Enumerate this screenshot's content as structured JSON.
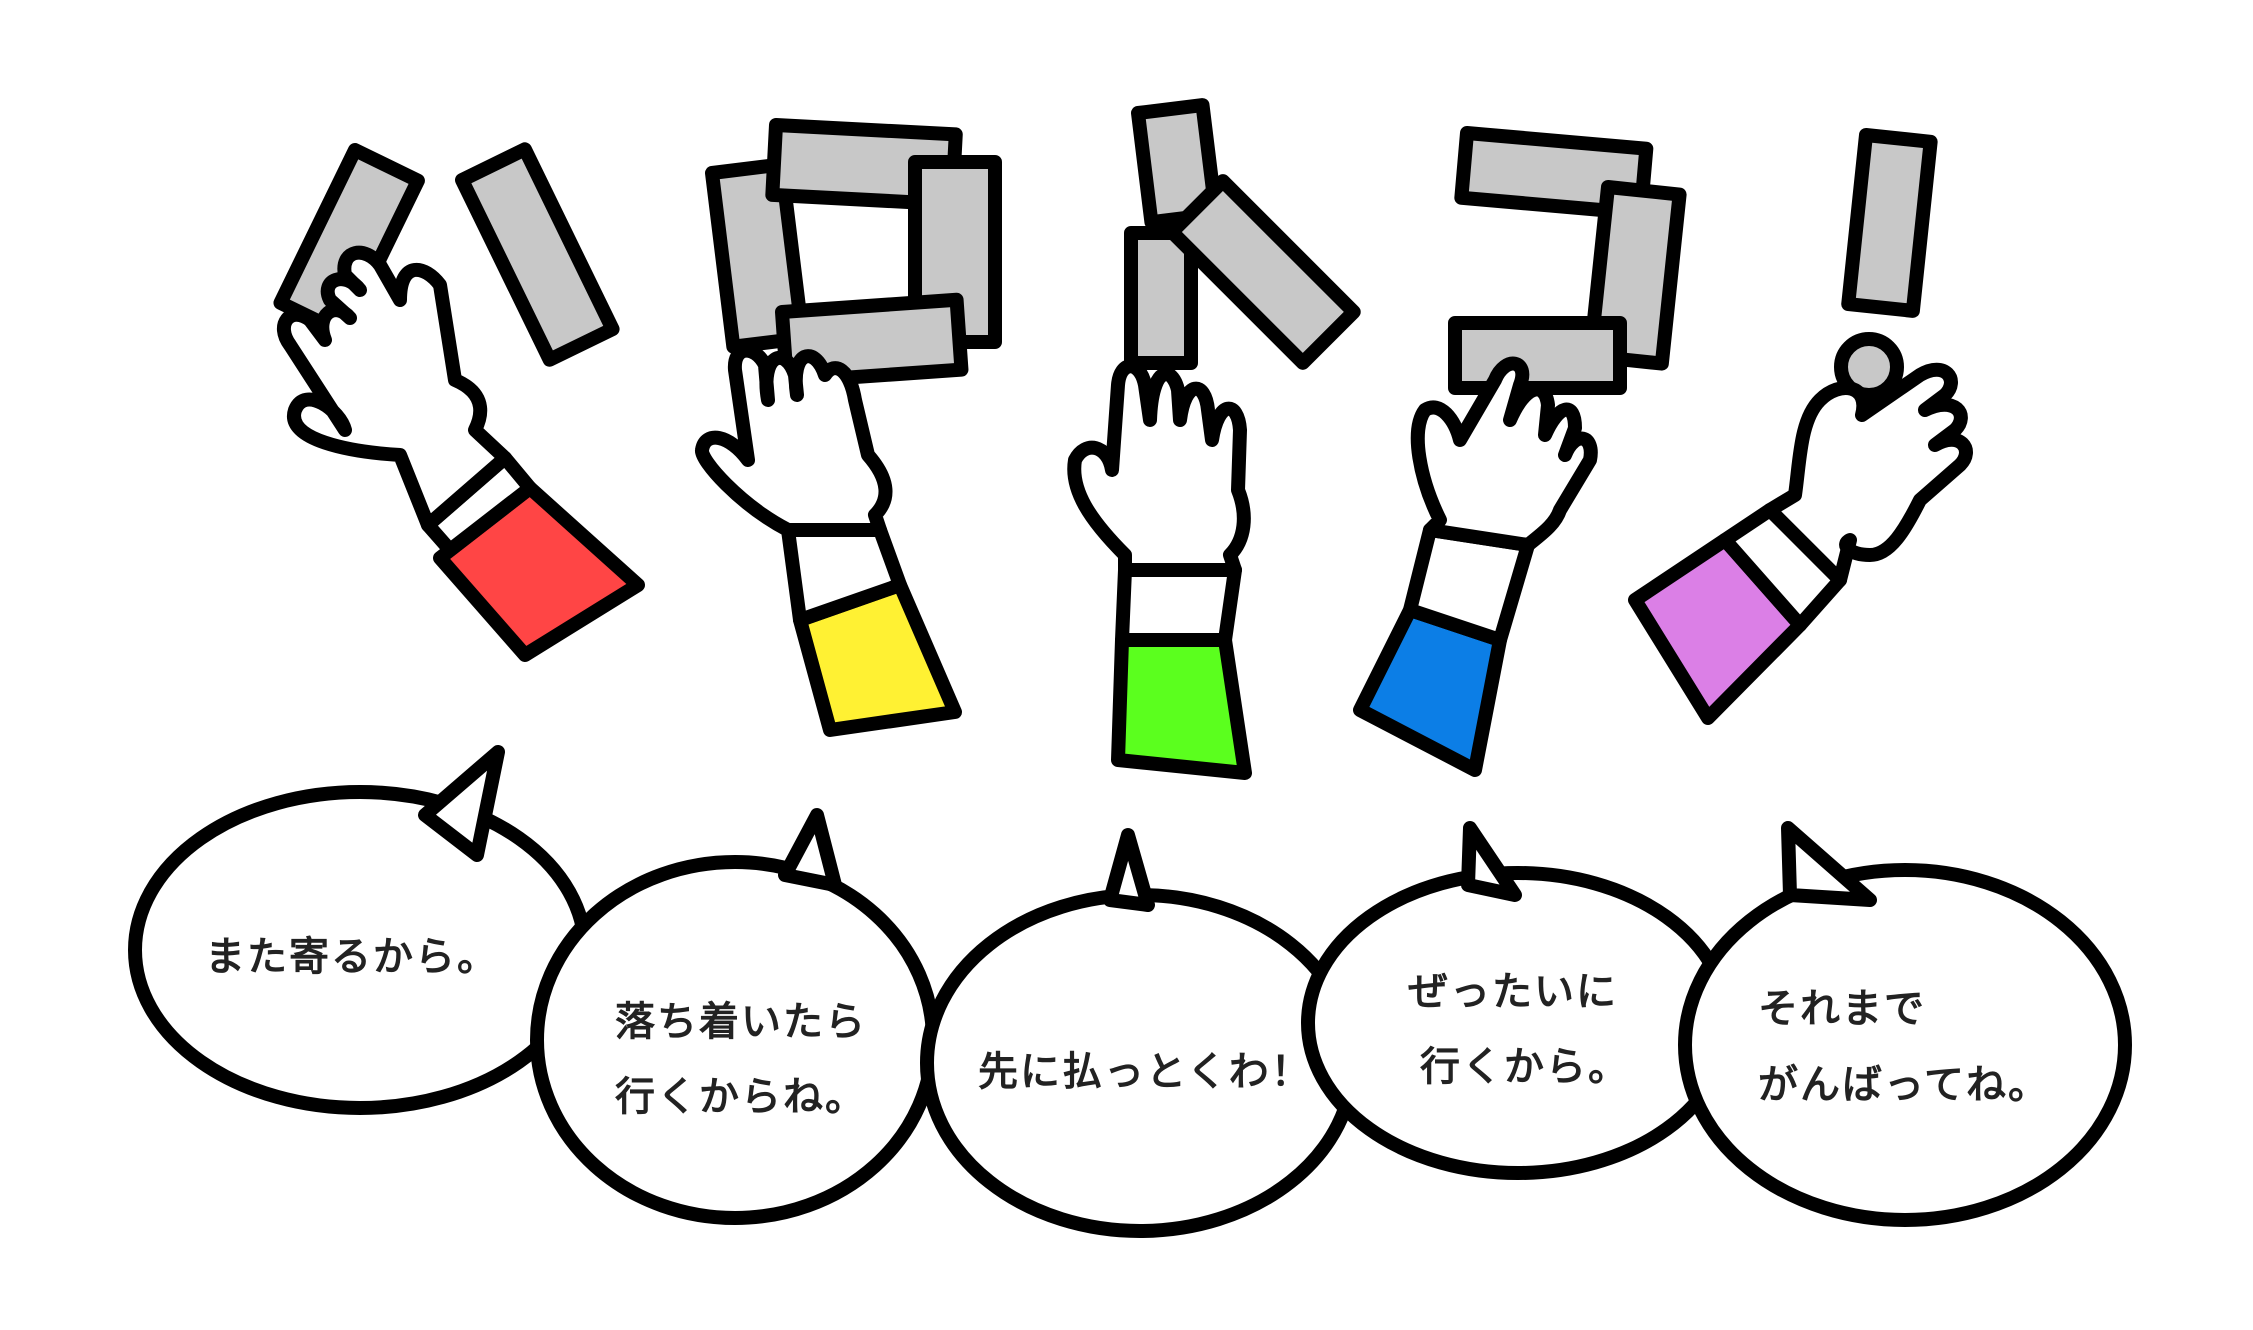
{
  "colors": {
    "card": "#c8c8c8",
    "outline": "#000000",
    "glove": "#ffffff",
    "bubble_fill": "#ffffff",
    "text": "#222222"
  },
  "sleeve_colors": [
    "#ff4545",
    "#fff133",
    "#5bff1e",
    "#0c7ee6",
    "#db7fe6"
  ],
  "bubbles": [
    {
      "lines": [
        "また寄るから。"
      ]
    },
    {
      "lines": [
        "落ち着いたら",
        "行くからね。"
      ]
    },
    {
      "lines": [
        "先に払っとくわ！"
      ]
    },
    {
      "lines": [
        "ぜったいに",
        "行くから。"
      ]
    },
    {
      "lines": [
        "それまで",
        "がんばってね。"
      ]
    }
  ]
}
